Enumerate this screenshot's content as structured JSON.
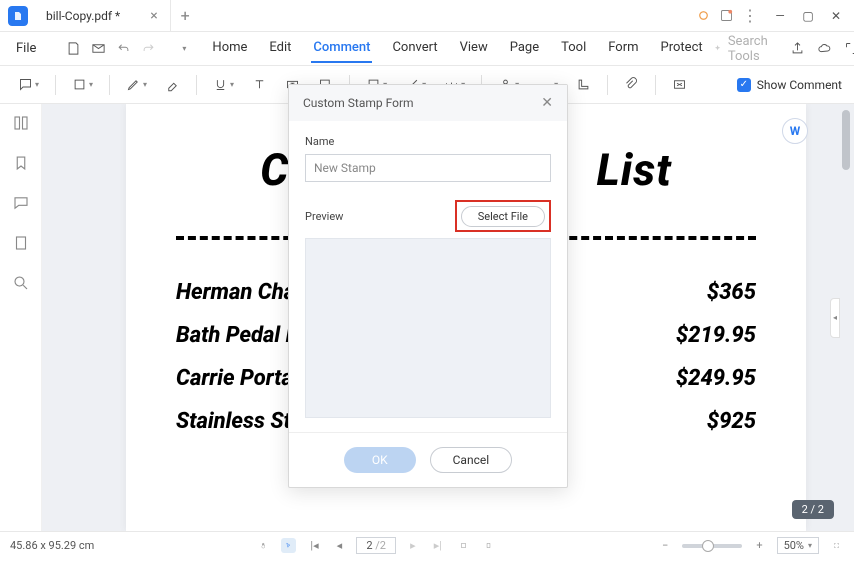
{
  "tab": {
    "title": "bill-Copy.pdf *"
  },
  "menu": {
    "file": "File",
    "tabs": [
      "Home",
      "Edit",
      "Comment",
      "Convert",
      "View",
      "Page",
      "Tool",
      "Form",
      "Protect"
    ],
    "active": "Comment",
    "search_placeholder": "Search Tools",
    "show_comment": "Show Comment"
  },
  "document": {
    "title_left": "Ca",
    "title_right": "List",
    "rows": [
      {
        "name": "Herman Cha",
        "price": "$365"
      },
      {
        "name": "Bath Pedal B",
        "price": "$219.95"
      },
      {
        "name": "Carrie Portable LED Lamp",
        "price": "$249.95"
      },
      {
        "name": "Stainless Steel Dining Chair",
        "price": "$925"
      }
    ]
  },
  "dialog": {
    "title": "Custom Stamp Form",
    "name_label": "Name",
    "name_value": "New Stamp",
    "preview_label": "Preview",
    "select_file": "Select File",
    "ok": "OK",
    "cancel": "Cancel"
  },
  "page_badge": "2 / 2",
  "status": {
    "coords": "45.86 x 95.29 cm",
    "page_current": "2",
    "page_total": "/2",
    "zoom": "50%"
  }
}
